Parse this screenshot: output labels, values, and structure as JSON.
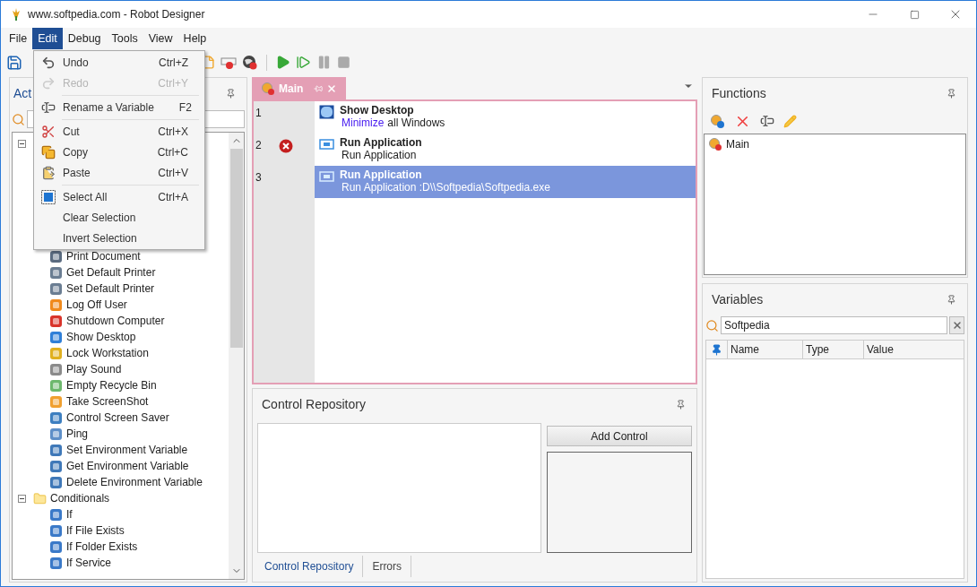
{
  "window": {
    "title": "www.softpedia.com - Robot Designer"
  },
  "menu_bar": [
    {
      "label": "File",
      "selected": false
    },
    {
      "label": "Edit",
      "selected": true
    },
    {
      "label": "Debug",
      "selected": false
    },
    {
      "label": "Tools",
      "selected": false
    },
    {
      "label": "View",
      "selected": false
    },
    {
      "label": "Help",
      "selected": false
    }
  ],
  "edit_menu": [
    {
      "kind": "item",
      "label": "Undo",
      "shortcut": "Ctrl+Z",
      "disabled": false
    },
    {
      "kind": "item",
      "label": "Redo",
      "shortcut": "Ctrl+Y",
      "disabled": true
    },
    {
      "kind": "separator"
    },
    {
      "kind": "item",
      "label": "Rename a Variable",
      "shortcut": "F2",
      "disabled": false
    },
    {
      "kind": "separator"
    },
    {
      "kind": "item",
      "label": "Cut",
      "shortcut": "Ctrl+X",
      "disabled": false
    },
    {
      "kind": "item",
      "label": "Copy",
      "shortcut": "Ctrl+C",
      "disabled": false
    },
    {
      "kind": "item",
      "label": "Paste",
      "shortcut": "Ctrl+V",
      "disabled": false
    },
    {
      "kind": "separator"
    },
    {
      "kind": "item",
      "label": "Select All",
      "shortcut": "Ctrl+A",
      "disabled": false
    },
    {
      "kind": "item",
      "label": "Clear Selection",
      "disabled": false
    },
    {
      "kind": "item",
      "label": "Invert Selection",
      "disabled": false
    }
  ],
  "actions_panel": {
    "title": "Act",
    "tree": [
      {
        "expanded": true,
        "children": [
          {
            "label": "Print Document"
          },
          {
            "label": "Get Default Printer"
          },
          {
            "label": "Set Default Printer"
          },
          {
            "label": "Log Off User"
          },
          {
            "label": "Shutdown Computer"
          },
          {
            "label": "Show Desktop"
          },
          {
            "label": "Lock Workstation"
          },
          {
            "label": "Play Sound"
          },
          {
            "label": "Empty Recycle Bin"
          },
          {
            "label": "Take ScreenShot"
          },
          {
            "label": "Control Screen Saver"
          },
          {
            "label": "Ping"
          },
          {
            "label": "Set Environment Variable"
          },
          {
            "label": "Get Environment Variable"
          },
          {
            "label": "Delete Environment Variable"
          }
        ]
      },
      {
        "label": "Conditionals",
        "expanded": true,
        "children": [
          {
            "label": "If"
          },
          {
            "label": "If File Exists"
          },
          {
            "label": "If Folder Exists"
          },
          {
            "label": "If Service"
          }
        ]
      }
    ]
  },
  "editor": {
    "tab": {
      "label": "Main"
    },
    "lines": [
      {
        "number": "1",
        "error": false,
        "selected": false,
        "title": "Show Desktop",
        "detail": [
          {
            "kind": "keyword",
            "text": "Minimize"
          },
          {
            "kind": "plain",
            "text": "all Windows"
          }
        ]
      },
      {
        "number": "2",
        "error": true,
        "selected": false,
        "title": "Run Application",
        "detail": [
          {
            "kind": "plain",
            "text": "Run Application"
          }
        ]
      },
      {
        "number": "3",
        "error": false,
        "selected": true,
        "title": "Run Application",
        "detail": [
          {
            "kind": "plain",
            "text": "Run Application :D\\\\Softpedia\\Softpedia.exe"
          }
        ]
      }
    ]
  },
  "control_repository": {
    "title": "Control Repository",
    "button": "Add Control",
    "tabs": [
      {
        "label": "Control Repository",
        "selected": true
      },
      {
        "label": "Errors",
        "selected": false
      }
    ]
  },
  "functions": {
    "title": "Functions",
    "items": [
      {
        "label": "Main"
      }
    ]
  },
  "variables": {
    "title": "Variables",
    "search": {
      "value": "Softpedia"
    },
    "columns": [
      "Name",
      "Type",
      "Value"
    ]
  }
}
